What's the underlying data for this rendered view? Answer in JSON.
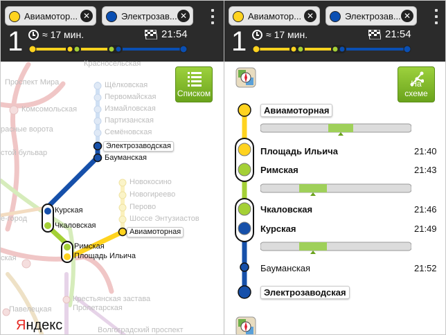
{
  "route": {
    "from": "Авиамоторная",
    "from_label": "Авиамотор...",
    "to": "Электрозаводская",
    "to_label": "Электрозав...",
    "index": "1",
    "duration": "≈ 17 мин.",
    "arrival": "21:54",
    "from_color": "#ffd31f",
    "to_color": "#0a4fb3"
  },
  "icons": {
    "clear": "close-icon",
    "menu": "overflow-menu-icon",
    "clock": "clock-icon",
    "finish": "finish-flag-icon",
    "list": "list-icon",
    "scheme": "scheme-icon",
    "compass": "compass-icon"
  },
  "buttons": {
    "list": "Списком",
    "scheme": "На схеме"
  },
  "map": {
    "faint_labels": [
      "Красносельская",
      "Щёлковская",
      "Первомайская",
      "Измайловская",
      "Партизанская",
      "Семёновская",
      "Новокосино",
      "Новогиреево",
      "Перово",
      "Шоссе Энтузиастов",
      "Комсомольская",
      "расные ворота",
      "стой бульвар",
      "е-город",
      "ская",
      "Павелецкая",
      "Крестьянская застава",
      "Пролетарская",
      "Волгоградский проспект",
      "Проспект Мира"
    ],
    "route_labels": {
      "elektro": "Электрозаводская",
      "bauman": "Бауманская",
      "kursk": "Курская",
      "chkal": "Чкаловская",
      "rim": "Римская",
      "ilich": "Площадь Ильича",
      "avia": "Авиамоторная"
    },
    "brand_first": "Я",
    "brand_rest": "ндекс"
  },
  "stations": [
    {
      "name": "Авиамоторная",
      "time": "",
      "style": "terminal"
    },
    {
      "name": "Площадь Ильича",
      "time": "21:40",
      "style": "transfer"
    },
    {
      "name": "Римская",
      "time": "21:43",
      "style": "transfer"
    },
    {
      "name": "Чкаловская",
      "time": "21:46",
      "style": "transfer"
    },
    {
      "name": "Курская",
      "time": "21:49",
      "style": "transfer"
    },
    {
      "name": "Бауманская",
      "time": "21:52",
      "style": "plain"
    },
    {
      "name": "Электрозаводская",
      "time": "",
      "style": "terminal"
    }
  ]
}
